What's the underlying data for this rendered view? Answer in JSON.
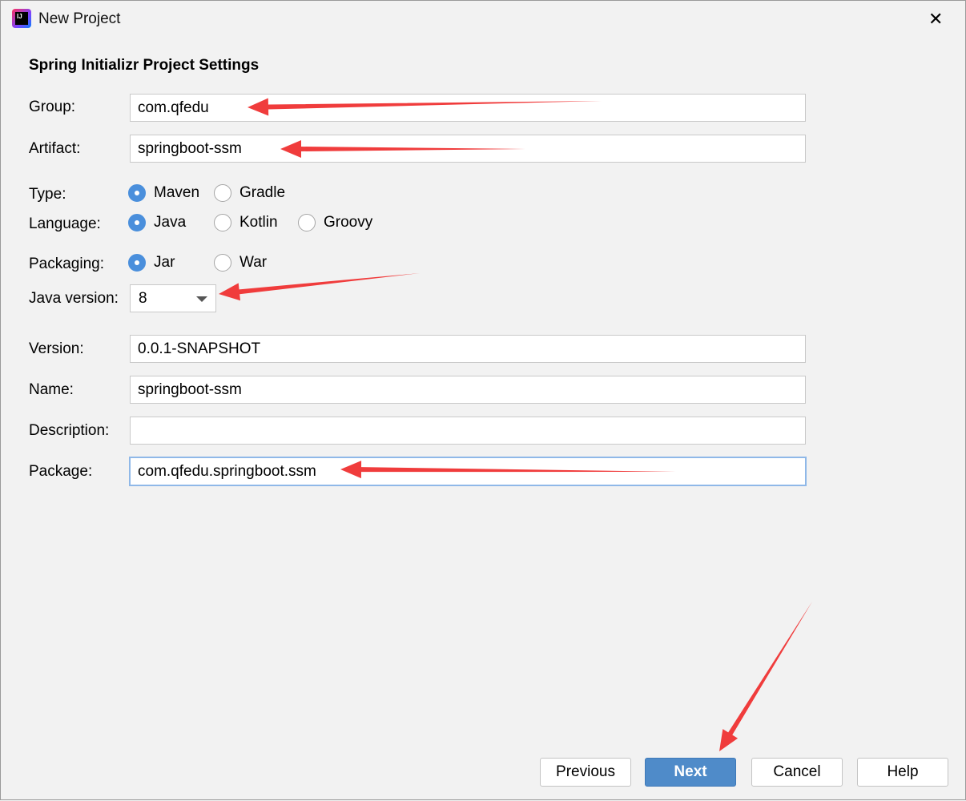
{
  "window": {
    "title": "New Project",
    "close_icon": "close-icon",
    "logo_text": "IJ"
  },
  "heading": "Spring Initializr Project Settings",
  "fields": {
    "group": {
      "label": "Group:",
      "value": "com.qfedu"
    },
    "artifact": {
      "label": "Artifact:",
      "value": "springboot-ssm"
    },
    "version": {
      "label": "Version:",
      "value": "0.0.1-SNAPSHOT"
    },
    "name": {
      "label": "Name:",
      "value": "springboot-ssm"
    },
    "description": {
      "label": "Description:",
      "value": ""
    },
    "package": {
      "label": "Package:",
      "value": "com.qfedu.springboot.ssm"
    }
  },
  "type": {
    "label": "Type:",
    "options": [
      "Maven",
      "Gradle"
    ],
    "selected": "Maven"
  },
  "language": {
    "label": "Language:",
    "options": [
      "Java",
      "Kotlin",
      "Groovy"
    ],
    "selected": "Java"
  },
  "packaging": {
    "label": "Packaging:",
    "options": [
      "Jar",
      "War"
    ],
    "selected": "Jar"
  },
  "java_version": {
    "label": "Java version:",
    "value": "8"
  },
  "buttons": {
    "previous": "Previous",
    "next": "Next",
    "cancel": "Cancel",
    "help": "Help"
  },
  "colors": {
    "accent": "#4f8bc9",
    "annotation": "#f03c3c"
  }
}
